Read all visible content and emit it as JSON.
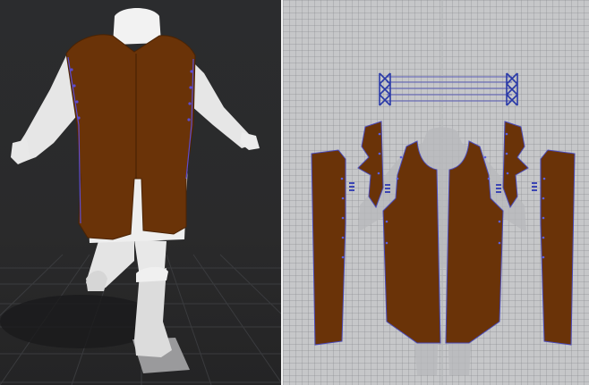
{
  "app": {
    "name": "",
    "panels": [
      {
        "id": "3d-window",
        "content": "avatar-with-garment"
      },
      {
        "id": "2d-window",
        "content": "pattern-pieces"
      }
    ]
  },
  "colors": {
    "garment": "#6a3308",
    "garment_edge": "#4a2304",
    "seam": "#5c4cd0",
    "undergarment": "#e6e6e6",
    "grid_3d": "#3a3b3e",
    "grid_2d": "#c6c7c9",
    "divider": "#f2f2f2"
  },
  "icons": [
    "lacing-symbol-icon",
    "grainline-icon"
  ]
}
